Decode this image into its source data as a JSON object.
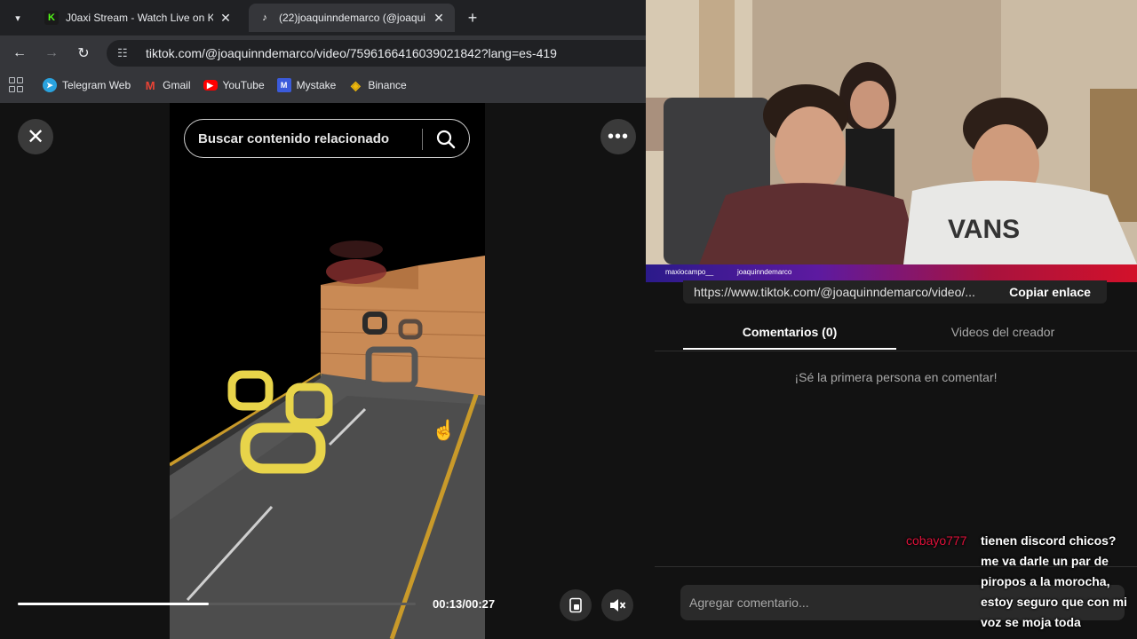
{
  "browser": {
    "tabs": [
      {
        "title": "J0axi Stream - Watch Live on Ki",
        "favicon": "kick-icon",
        "active": false
      },
      {
        "title": "(22)joaquinndemarco (@joaqui",
        "favicon": "tiktok-icon",
        "active": true
      }
    ],
    "address": "tiktok.com/@joaquinndemarco/video/7596166416039021842?lang=es-419",
    "bookmarks": [
      {
        "label": "Telegram Web",
        "color": "#2aa3df"
      },
      {
        "label": "Gmail",
        "color": "#ea4335"
      },
      {
        "label": "YouTube",
        "color": "#ff0000"
      },
      {
        "label": "Mystake",
        "color": "#3b5bdb"
      },
      {
        "label": "Binance",
        "color": "#f0b90b"
      }
    ]
  },
  "video": {
    "search_placeholder": "Buscar contenido relacionado",
    "time": "00:13/00:27",
    "progress": 0.48
  },
  "webcam": {
    "names": [
      "maxiocampo__",
      "joaquinndemarco"
    ]
  },
  "panel": {
    "link": "https://www.tiktok.com/@joaquinndemarco/video/...",
    "copy_label": "Copiar enlace",
    "tab_comments": "Comentarios (0)",
    "tab_creator": "Videos del creador",
    "empty_message": "¡Sé la primera persona en comentar!",
    "comment_placeholder": "Agregar comentario..."
  },
  "chat": {
    "user": "cobayo777",
    "message": "tienen discord chicos? me va darle un par de piropos a la morocha, estoy seguro que con mi voz se moja toda"
  }
}
